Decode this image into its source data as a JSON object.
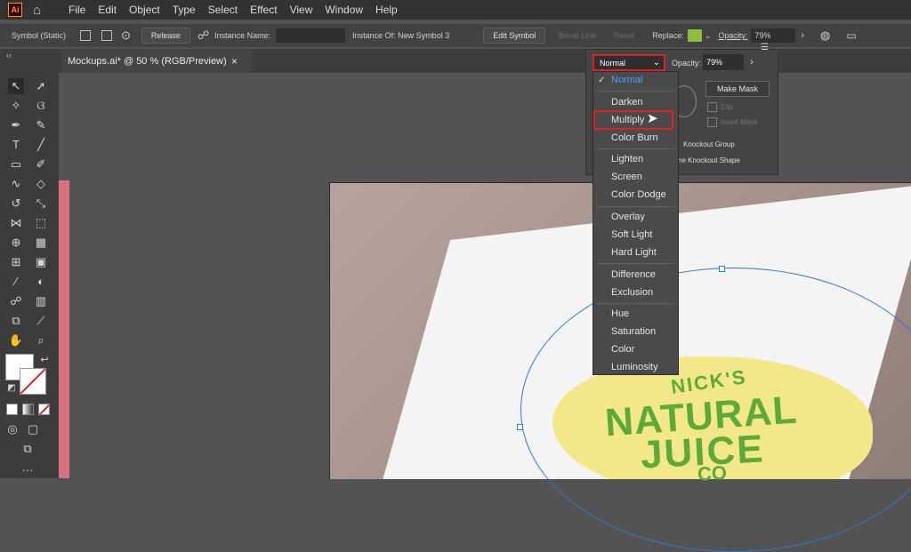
{
  "app": {
    "logo": "Ai",
    "home_icon": "home-icon"
  },
  "menu": [
    "File",
    "Edit",
    "Object",
    "Type",
    "Select",
    "Effect",
    "View",
    "Window",
    "Help"
  ],
  "control_bar": {
    "selection_type": "Symbol (Static)",
    "release": "Release",
    "instance_name_label": "Instance Name:",
    "instance_of": "Instance Of: New Symbol 3",
    "edit_symbol": "Edit Symbol",
    "break_link": "Break Link",
    "reset": "Reset",
    "replace_label": "Replace:",
    "opacity_label": "Opacity:",
    "opacity_value": "79%"
  },
  "tab": {
    "title": "Mockups.ai* @ 50 % (RGB/Preview)",
    "close": "×"
  },
  "transparency": {
    "blend_mode": "Normal",
    "opacity_label": "Opacity:",
    "opacity_value": "79%",
    "make_mask": "Make Mask",
    "clip": "Clip",
    "invert_mask": "Invert Mask",
    "knockout_group": "Knockout Group",
    "knockout_shape": "ne Knockout Shape"
  },
  "blend_menu": [
    {
      "label": "Normal",
      "selected": true
    },
    {
      "label": "Darken"
    },
    {
      "label": "Multiply",
      "hovered": true
    },
    {
      "label": "Color Burn"
    },
    {
      "label": "Lighten"
    },
    {
      "label": "Screen"
    },
    {
      "label": "Color Dodge"
    },
    {
      "label": "Overlay"
    },
    {
      "label": "Soft Light"
    },
    {
      "label": "Hard Light"
    },
    {
      "label": "Difference"
    },
    {
      "label": "Exclusion"
    },
    {
      "label": "Hue"
    },
    {
      "label": "Saturation"
    },
    {
      "label": "Color"
    },
    {
      "label": "Luminosity"
    }
  ],
  "artwork": {
    "line1": "NICK'S",
    "line2": "NATURAL",
    "line3": "JUICE",
    "line4": "CO"
  },
  "colors": {
    "accent": "#d7222a",
    "selected": "#4aa0ff",
    "brand_green": "#5fa93b",
    "label_yellow": "#f2e889"
  }
}
